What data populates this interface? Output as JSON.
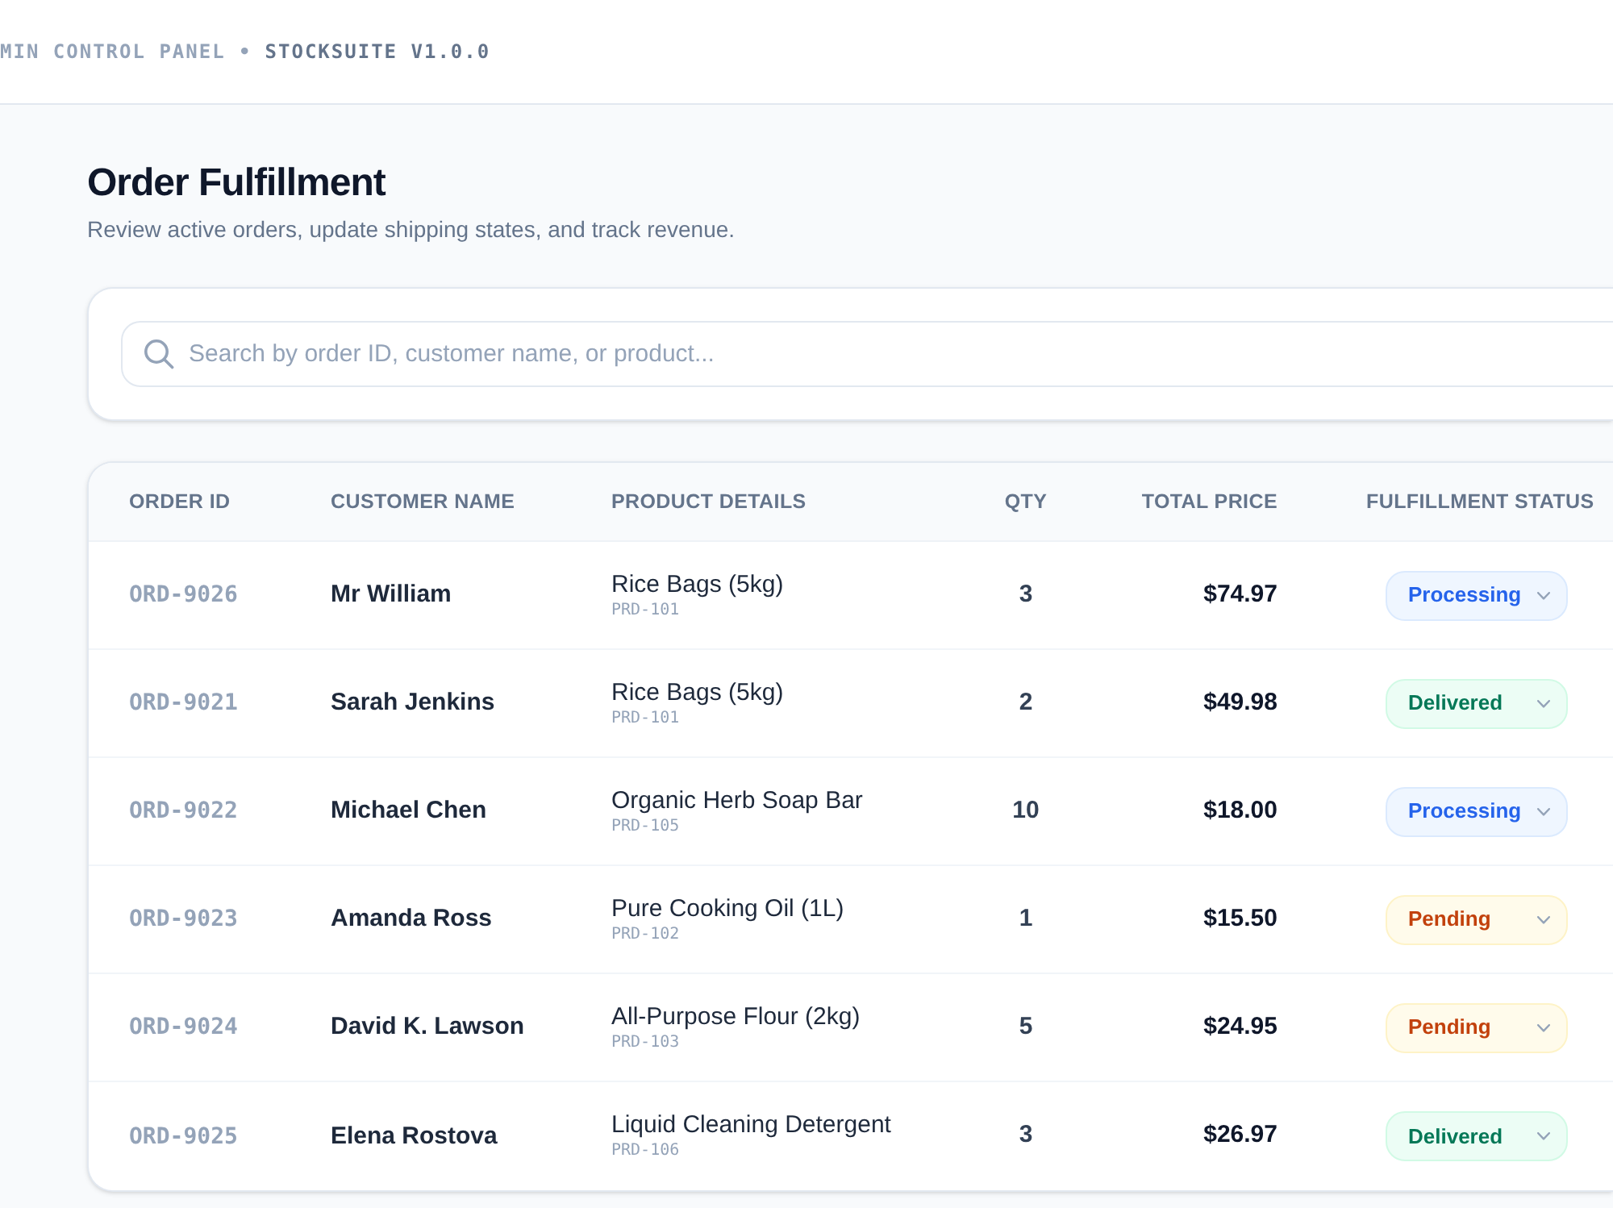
{
  "header": {
    "breadcrumb": "MIN CONTROL PANEL •",
    "app": "STOCKSUITE V1.0.0"
  },
  "page": {
    "title": "Order Fulfillment",
    "subtitle": "Review active orders, update shipping states, and track revenue."
  },
  "search": {
    "placeholder": "Search by order ID, customer name, or product..."
  },
  "table": {
    "columns": [
      "ORDER ID",
      "CUSTOMER NAME",
      "PRODUCT DETAILS",
      "QTY",
      "TOTAL PRICE",
      "FULFILLMENT STATUS"
    ],
    "rows": [
      {
        "order_id": "ORD-9026",
        "customer": "Mr William",
        "product": "Rice Bags (5kg)",
        "sku": "PRD-101",
        "qty": "3",
        "total": "$74.97",
        "status": {
          "label": "Processing",
          "kind": "processing"
        }
      },
      {
        "order_id": "ORD-9021",
        "customer": "Sarah Jenkins",
        "product": "Rice Bags (5kg)",
        "sku": "PRD-101",
        "qty": "2",
        "total": "$49.98",
        "status": {
          "label": "Delivered",
          "kind": "delivered"
        }
      },
      {
        "order_id": "ORD-9022",
        "customer": "Michael Chen",
        "product": "Organic Herb Soap Bar",
        "sku": "PRD-105",
        "qty": "10",
        "total": "$18.00",
        "status": {
          "label": "Processing",
          "kind": "processing"
        }
      },
      {
        "order_id": "ORD-9023",
        "customer": "Amanda Ross",
        "product": "Pure Cooking Oil (1L)",
        "sku": "PRD-102",
        "qty": "1",
        "total": "$15.50",
        "status": {
          "label": "Pending",
          "kind": "pending"
        }
      },
      {
        "order_id": "ORD-9024",
        "customer": "David K. Lawson",
        "product": "All-Purpose Flour (2kg)",
        "sku": "PRD-103",
        "qty": "5",
        "total": "$24.95",
        "status": {
          "label": "Pending",
          "kind": "pending"
        }
      },
      {
        "order_id": "ORD-9025",
        "customer": "Elena Rostova",
        "product": "Liquid Cleaning Detergent",
        "sku": "PRD-106",
        "qty": "3",
        "total": "$26.97",
        "status": {
          "label": "Delivered",
          "kind": "delivered"
        }
      }
    ]
  }
}
